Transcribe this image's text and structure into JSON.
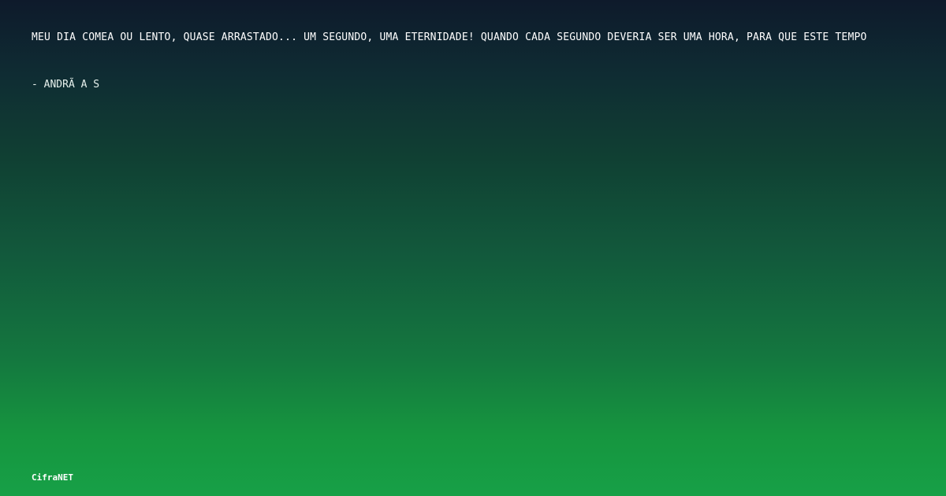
{
  "quote": {
    "text": "MEU DIA COMEÃ OU LENTO, QUASE ARRASTADO... UM SEGUNDO, UMA ETERNIDADE! QUANDO CADA SEGUNDO DEVERIA SER UMA HORA, PARA QUE ESTE TEMPO",
    "author": "- ANDRÃ A S"
  },
  "brand": {
    "name": "CifraNET"
  },
  "colors": {
    "gradient_top": "#0e1a2b",
    "gradient_bottom": "#17a047",
    "text": "#ffffff"
  }
}
